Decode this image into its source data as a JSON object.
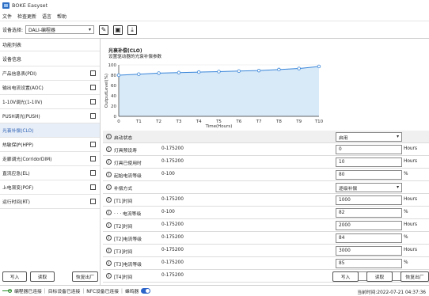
{
  "window": {
    "title": "BOKE Easyset"
  },
  "menu": [
    "文件",
    "检查更新",
    "语言",
    "帮助"
  ],
  "toolbar": {
    "device_label": "设备选择:",
    "device_value": "DALI-编程器",
    "icons": [
      "edit-icon",
      "save-icon",
      "download-icon"
    ]
  },
  "sidebar": {
    "title": "功能列表",
    "section": "设备信息",
    "items": [
      {
        "label": "产品信息表(PDI)",
        "active": false
      },
      {
        "label": "输出电流设置(AOC)",
        "active": false
      },
      {
        "label": "1-10V调光(1-10V)",
        "active": false
      },
      {
        "label": "PUSH调光(PUSH)",
        "active": false
      },
      {
        "label": "光衰补偿(CLO)",
        "active": true
      },
      {
        "label": "热敏保护(HPP)",
        "active": false
      },
      {
        "label": "走廊调光(CorridorDIM)",
        "active": false
      },
      {
        "label": "直流应急(EL)",
        "active": false
      },
      {
        "label": "上电渐变(POF)",
        "active": false
      },
      {
        "label": "运行时间(RT)",
        "active": false
      }
    ],
    "buttons": {
      "write": "写入",
      "read": "读取",
      "reset": "恢复出厂"
    }
  },
  "chart": {
    "title": "光衰补偿(CLO)",
    "subtitle": "设置驱动器的光衰补偿参数"
  },
  "chart_data": {
    "type": "area",
    "categories": [
      "0",
      "T1",
      "T2",
      "T3",
      "T4",
      "T5",
      "T6",
      "T7",
      "T8",
      "T9",
      "T10"
    ],
    "values": [
      80,
      82,
      84,
      85,
      86,
      87,
      88,
      89,
      91,
      93,
      97
    ],
    "xlabel": "Time(Hours)",
    "ylabel": "OutputLevel(%)",
    "ylim": [
      0,
      100
    ],
    "yticks": [
      "0",
      "20",
      "40",
      "60",
      "80",
      "100"
    ],
    "line_color": "#3a86d9",
    "fill_color": "#d8e9f8"
  },
  "params": [
    {
      "label": "启动状态",
      "range": "",
      "value": "启用",
      "unit": "",
      "dropdown": true,
      "header": true
    },
    {
      "label": "灯具预设寿",
      "range": "0-175200",
      "value": "0",
      "unit": "Hours",
      "dropdown": false,
      "header": false
    },
    {
      "label": "灯具已使用时",
      "range": "0-175200",
      "value": "10",
      "unit": "Hours",
      "dropdown": false,
      "header": false
    },
    {
      "label": "起始电流等级",
      "range": "0-100",
      "value": "80",
      "unit": "%",
      "dropdown": false,
      "header": false
    },
    {
      "label": "补偿方式",
      "range": "",
      "value": "逐级补偿",
      "unit": "",
      "dropdown": true,
      "header": false
    },
    {
      "label": "[T1]时间",
      "range": "0-175200",
      "value": "1000",
      "unit": "Hours",
      "dropdown": false,
      "header": false
    },
    {
      "label": "· · · 电流等级",
      "range": "0-100",
      "value": "82",
      "unit": "%",
      "dropdown": false,
      "header": false
    },
    {
      "label": "[T2]时间",
      "range": "0-175200",
      "value": "2000",
      "unit": "Hours",
      "dropdown": false,
      "header": false
    },
    {
      "label": "[T2]电流等级",
      "range": "0-175200",
      "value": "84",
      "unit": "%",
      "dropdown": false,
      "header": false
    },
    {
      "label": "[T3]时间",
      "range": "0-175200",
      "value": "3000",
      "unit": "Hours",
      "dropdown": false,
      "header": false
    },
    {
      "label": "[T3]电流等级",
      "range": "0-175200",
      "value": "85",
      "unit": "%",
      "dropdown": false,
      "header": false
    },
    {
      "label": "[T4]时间",
      "range": "0-175200",
      "value": "4000",
      "unit": "Hours",
      "dropdown": false,
      "header": false
    }
  ],
  "action_buttons": {
    "write": "写入",
    "read": "读取",
    "reset": "恢复出厂"
  },
  "status": {
    "programmer": "编程器已连接",
    "target": "目标设备已连接",
    "nfc": "NFC设备已连接",
    "buzzer": "蜂鸣器",
    "time": "当前时间:2022-07-21 04:37:36"
  }
}
